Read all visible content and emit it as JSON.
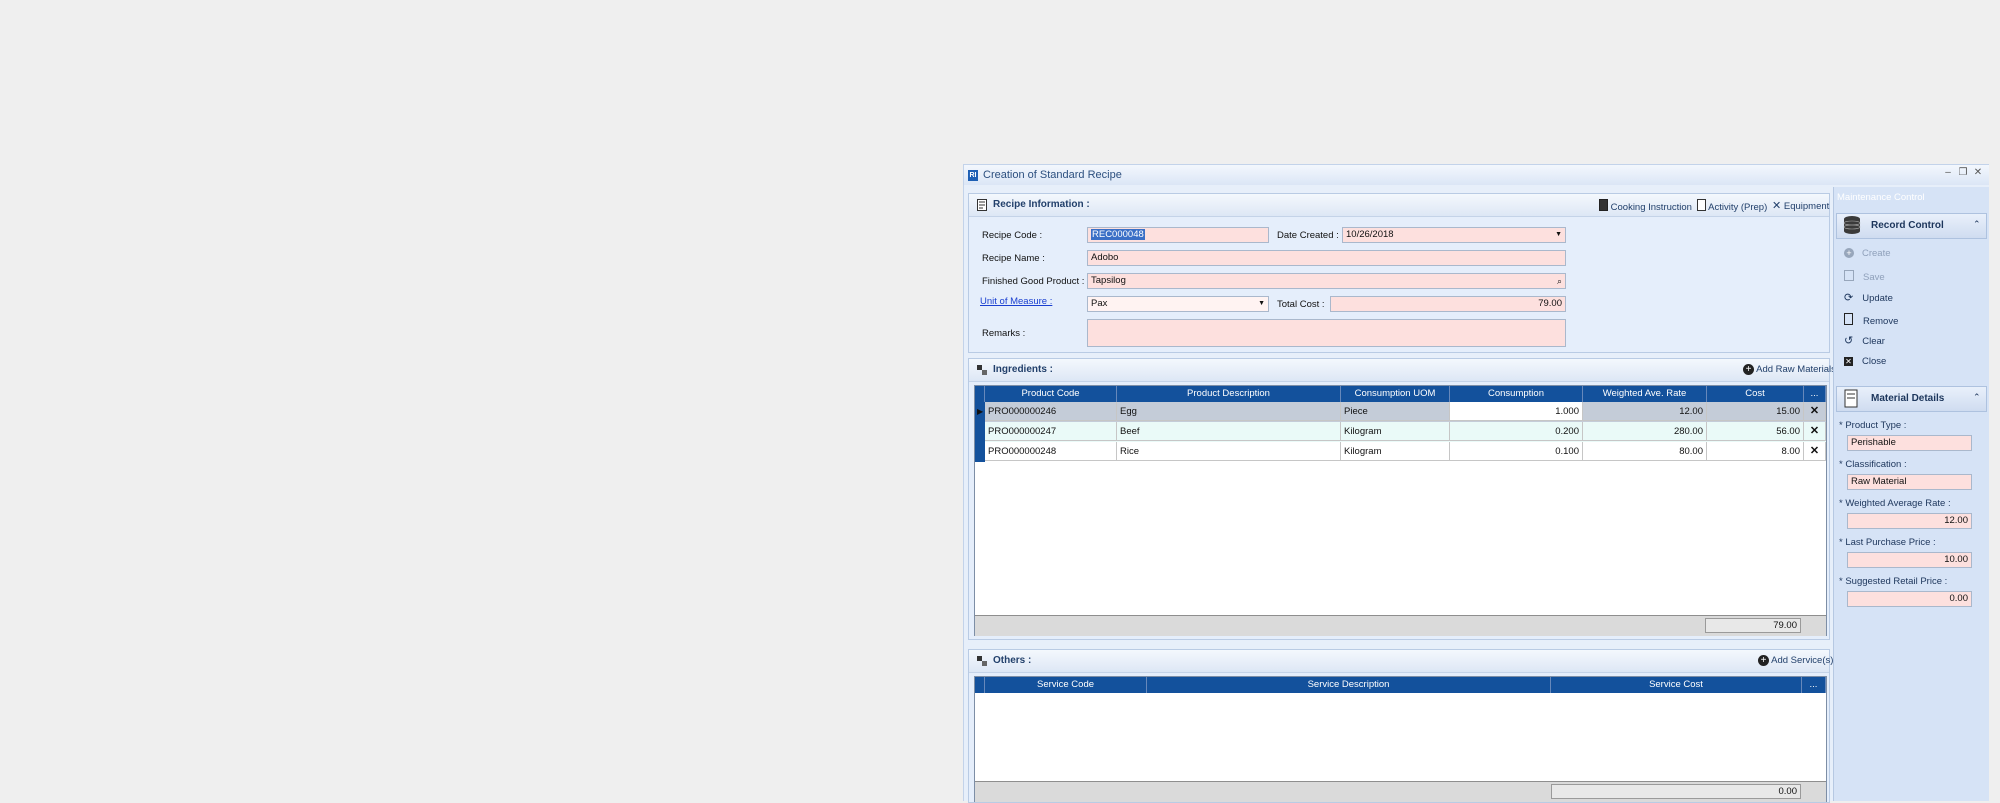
{
  "window": {
    "title": "Creation of Standard Recipe",
    "app_icon": "RI"
  },
  "recipe_info": {
    "title": "Recipe Information :",
    "tools": {
      "cooking": "Cooking Instruction",
      "activity": "Activity (Prep)",
      "equipment": "Equipment"
    },
    "labels": {
      "recipe_code": "Recipe Code :",
      "date_created": "Date Created :",
      "recipe_name": "Recipe Name :",
      "finished_good": "Finished Good Product :",
      "uom": "Unit of Measure :",
      "total_cost": "Total Cost :",
      "remarks": "Remarks :"
    },
    "values": {
      "recipe_code": "REC000048",
      "date_created": "10/26/2018",
      "recipe_name": "Adobo",
      "finished_good": "Tapsilog",
      "uom": "Pax",
      "total_cost": "79.00",
      "remarks": ""
    }
  },
  "ingredients": {
    "title": "Ingredients :",
    "add_label": "Add Raw Materials",
    "columns": [
      "Product Code",
      "Product Description",
      "Consumption UOM",
      "Consumption",
      "Weighted Ave. Rate",
      "Cost",
      "..."
    ],
    "rows": [
      [
        "PRO000000246",
        "Egg",
        "Piece",
        "1.000",
        "12.00",
        "15.00"
      ],
      [
        "PRO000000247",
        "Beef",
        "Kilogram",
        "0.200",
        "280.00",
        "56.00"
      ],
      [
        "PRO000000248",
        "Rice",
        "Kilogram",
        "0.100",
        "80.00",
        "8.00"
      ]
    ],
    "total": "79.00"
  },
  "others": {
    "title": "Others :",
    "add_label": "Add Service(s)",
    "columns": [
      "Service Code",
      "Service Description",
      "Service Cost",
      "..."
    ],
    "total": "0.00"
  },
  "side": {
    "header": "Maintenance Control",
    "record_control": {
      "title": "Record Control",
      "items": [
        "Create",
        "Save",
        "Update",
        "Remove",
        "Clear",
        "Close"
      ]
    },
    "material_details": {
      "title": "Material Details",
      "labels": [
        "* Product Type :",
        "* Classification :",
        "* Weighted Average Rate :",
        "* Last Purchase Price :",
        "* Suggested Retail Price :"
      ],
      "values": [
        "Perishable",
        "Raw Material",
        "12.00",
        "10.00",
        "0.00"
      ]
    }
  }
}
